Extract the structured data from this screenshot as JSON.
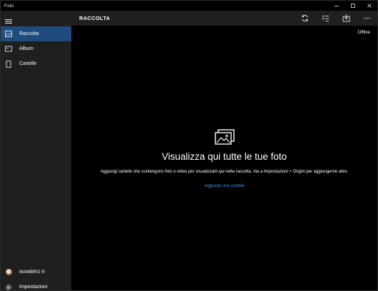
{
  "window": {
    "title": "Foto",
    "controls": {
      "minimize": "minimize-icon",
      "maximize": "maximize-icon",
      "close": "close-icon"
    }
  },
  "sidebar": {
    "menu_icon": "hamburger-icon",
    "items": [
      {
        "label": "Raccolta",
        "icon": "collection-icon",
        "active": true
      },
      {
        "label": "Album",
        "icon": "album-icon",
        "active": false
      },
      {
        "label": "Cartelle",
        "icon": "folder-icon",
        "active": false
      }
    ],
    "account": {
      "label": "MAMBRO ®",
      "icon": "avatar"
    },
    "settings": {
      "label": "Impostazioni",
      "icon": "gear-icon"
    }
  },
  "header": {
    "title": "RACCOLTA",
    "actions": [
      "refresh-icon",
      "select-icon",
      "import-icon",
      "more-icon"
    ]
  },
  "main": {
    "status": "Offline",
    "empty_state": {
      "icon": "photos-icon",
      "title": "Visualizza qui tutte le tue foto",
      "description": "Aggiungi cartelle che contengono foto o video per visualizzarli qui nella raccolta. Vai a Impostazioni > Origini per aggiungerne altre.",
      "link": "Aggiungi una cartella"
    }
  },
  "colors": {
    "accent": "#1f4c7e",
    "link": "#3a8fe0",
    "sidebar_bg": "#1f1f1f",
    "content_bg": "#000000"
  }
}
